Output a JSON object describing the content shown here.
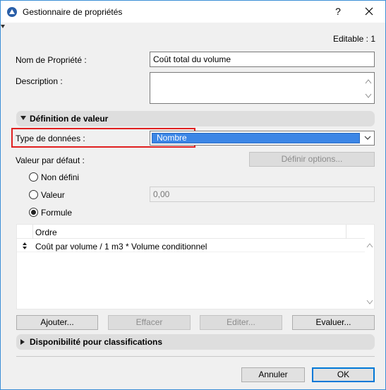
{
  "window": {
    "title": "Gestionnaire de propriétés",
    "help": "?",
    "editable": "Editable : 1"
  },
  "fields": {
    "name_label": "Nom de Propriété :",
    "name_value": "Coût total du volume",
    "description_label": "Description :",
    "description_value": ""
  },
  "section_definition": "Définition de valeur",
  "data_type": {
    "label": "Type de données :",
    "value": "Nombre"
  },
  "default_value": {
    "label": "Valeur par défaut :",
    "define_options": "Définir options...",
    "radio_undefined": "Non défini",
    "radio_value": "Valeur",
    "value_input": "0,00",
    "radio_formula": "Formule",
    "selected": "Formule"
  },
  "formula_list": {
    "column": "Ordre",
    "rows": [
      {
        "text": "Coût par volume / 1 m3 * Volume conditionnel"
      }
    ]
  },
  "list_buttons": {
    "add": "Ajouter...",
    "delete": "Effacer",
    "edit": "Editer...",
    "evaluate": "Evaluer..."
  },
  "section_classifications": "Disponibilité pour classifications",
  "footer": {
    "cancel": "Annuler",
    "ok": "OK"
  },
  "colors": {
    "selection": "#3c86e6",
    "highlight": "#e02020",
    "accent": "#0078d7"
  }
}
